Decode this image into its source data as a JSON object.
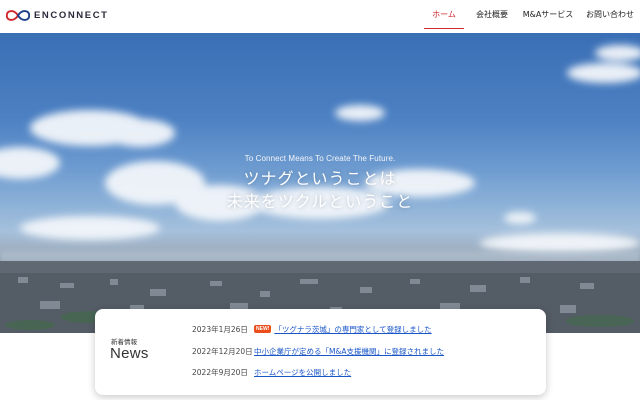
{
  "header": {
    "brand": "ENCONNECT",
    "nav": [
      {
        "label": "ホーム",
        "active": true
      },
      {
        "label": "会社概要",
        "active": false
      },
      {
        "label": "M&Aサービス",
        "active": false
      },
      {
        "label": "お問い合わせ",
        "active": false
      }
    ]
  },
  "hero": {
    "subtitle": "To Connect Means To Create The Future.",
    "title_line1": "ツナグということは",
    "title_line2": "未来をツクルということ"
  },
  "news": {
    "label": "新着情報",
    "heading": "News",
    "items": [
      {
        "date": "2023年1月26日",
        "badge": "NEW!",
        "text": "「ツグナラ茨城」の専門家として登録しました"
      },
      {
        "date": "2022年12月20日",
        "badge": "",
        "text": "中小企業庁が定める「M&A支援機関」に登録されました"
      },
      {
        "date": "2022年9月20日",
        "badge": "",
        "text": "ホームページを公開しました"
      }
    ]
  },
  "colors": {
    "accent": "#d0282e",
    "link": "#1a56c8",
    "badge": "#e94e1b",
    "logo_blue": "#1e3f8a"
  }
}
